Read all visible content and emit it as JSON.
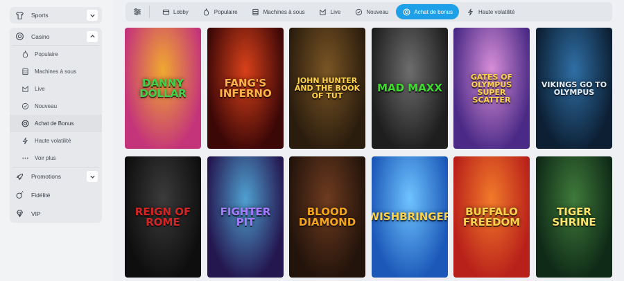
{
  "sidebar": {
    "sports": {
      "label": "Sports"
    },
    "casino": {
      "label": "Casino",
      "items": [
        {
          "label": "Populaire",
          "icon": "flame-icon"
        },
        {
          "label": "Machines à sous",
          "icon": "slot-machine-icon"
        },
        {
          "label": "Live",
          "icon": "live-icon"
        },
        {
          "label": "Nouveau",
          "icon": "check-circle-icon"
        },
        {
          "label": "Achat de Bonus",
          "icon": "bonus-icon",
          "active": true
        },
        {
          "label": "Haute volatilité",
          "icon": "lightning-icon"
        },
        {
          "label": "Voir plus",
          "icon": "more-dots-icon"
        }
      ]
    },
    "promotions": {
      "label": "Promotions"
    },
    "fidelite": {
      "label": "Fidélité"
    },
    "vip": {
      "label": "VIP"
    }
  },
  "filterbar": {
    "tabs": [
      {
        "label": "Lobby",
        "icon": "lobby-icon"
      },
      {
        "label": "Populaire",
        "icon": "flame-icon"
      },
      {
        "label": "Machines à sous",
        "icon": "slot-machine-icon"
      },
      {
        "label": "Live",
        "icon": "live-icon"
      },
      {
        "label": "Nouveau",
        "icon": "check-circle-icon"
      },
      {
        "label": "Achat de bonus",
        "icon": "bonus-icon",
        "active": true
      },
      {
        "label": "Haute volatilité",
        "icon": "lightning-icon"
      }
    ],
    "accent": "#1ea0e8"
  },
  "games": [
    {
      "title": "Danny Dollar",
      "colors": [
        "#c4347a",
        "#f0a830"
      ],
      "text": "#3fd24a"
    },
    {
      "title": "Fang's Inferno",
      "colors": [
        "#3b0707",
        "#d8411a"
      ],
      "text": "#ffb347"
    },
    {
      "title": "John Hunter and the Book of Tut",
      "colors": [
        "#2b1d0e",
        "#7a5524"
      ],
      "text": "#ffd24a"
    },
    {
      "title": "Mad Maxx",
      "colors": [
        "#1e1e1e",
        "#6d6d6d"
      ],
      "text": "#3edb2e"
    },
    {
      "title": "Gates of Olympus Super Scatter",
      "colors": [
        "#4a2a86",
        "#d88fd8"
      ],
      "text": "#ffd24a"
    },
    {
      "title": "Vikings Go To Olympus",
      "colors": [
        "#0c1f33",
        "#2f6fa5"
      ],
      "text": "#e8eef5"
    },
    {
      "title": "Reign of Rome",
      "colors": [
        "#0e0e0e",
        "#3b3b3b"
      ],
      "text": "#d42424"
    },
    {
      "title": "Fighter Pit",
      "colors": [
        "#24164f",
        "#4fa0d0"
      ],
      "text": "#a57bff"
    },
    {
      "title": "Blood Diamond",
      "colors": [
        "#22130b",
        "#6e3b1f"
      ],
      "text": "#f2a51b"
    },
    {
      "title": "Wishbringer",
      "colors": [
        "#1b58b8",
        "#6fc3ff"
      ],
      "text": "#ffd24a"
    },
    {
      "title": "Buffalo Freedom",
      "colors": [
        "#b8201a",
        "#f27a2a"
      ],
      "text": "#ffd24a"
    },
    {
      "title": "Tiger Shrine",
      "colors": [
        "#0f2a17",
        "#3f7a3a"
      ],
      "text": "#ffe36a"
    }
  ]
}
